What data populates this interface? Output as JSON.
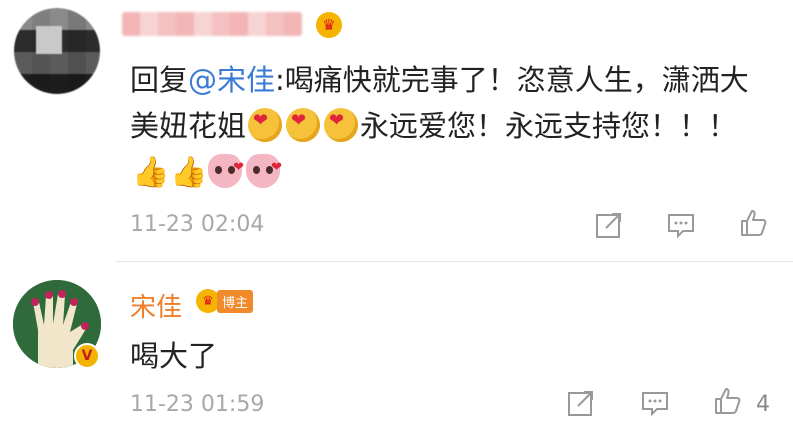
{
  "comments": [
    {
      "reply_prefix": "回复",
      "mention": "@宋佳",
      "text_part1": ":喝痛快就完事了！恣意人生，潇洒大美妞花姐",
      "text_part2": "永远爱您！永远支持您！！！",
      "emojis": [
        "heart-face",
        "heart-face",
        "heart-face",
        "thumbs-up",
        "thumbs-up",
        "pig",
        "pig"
      ],
      "timestamp": "11-23 02:04",
      "like_count": ""
    },
    {
      "author": "宋佳",
      "badge_label": "博主",
      "verified_mark": "V",
      "text": "喝大了",
      "timestamp": "11-23 01:59",
      "like_count": "4"
    }
  ],
  "colors": {
    "mention": "#3a7bd5",
    "author_name": "#f07e2a",
    "timestamp": "#a8a8a8",
    "badge": "#f08a2a"
  },
  "icons": [
    "share-icon",
    "comment-icon",
    "like-icon",
    "crown-icon",
    "verified-icon"
  ]
}
